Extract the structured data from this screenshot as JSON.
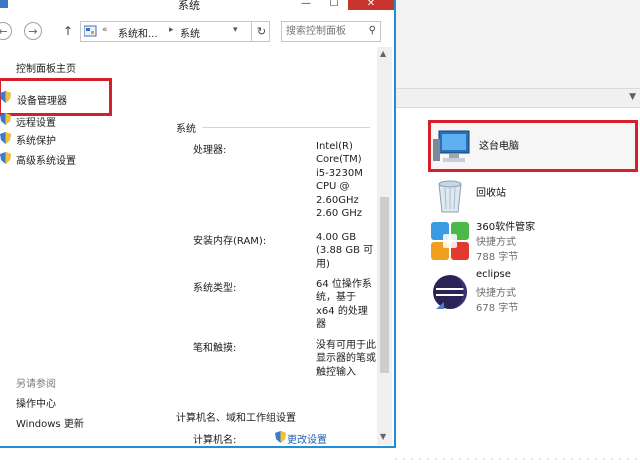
{
  "window": {
    "title": "系统",
    "controls": {
      "minimize": "—",
      "maximize": "☐",
      "close": "✕"
    }
  },
  "address_bar": {
    "back_icon": "back-arrow-icon",
    "forward_icon": "forward-arrow-icon",
    "up_icon": "up-arrow-icon",
    "prefix": "«",
    "crumbs": [
      "系统和...",
      "系统"
    ],
    "search_placeholder": "搜索控制面板"
  },
  "left_nav": {
    "home": "控制面板主页",
    "links": [
      "设备管理器",
      "远程设置",
      "系统保护",
      "高级系统设置"
    ],
    "see_also_title": "另请参阅",
    "see_also": [
      "操作中心",
      "Windows 更新"
    ]
  },
  "system_section": {
    "title": "系统",
    "rows": [
      {
        "label": "处理器:",
        "value": "Intel(R) Core(TM) i5-3230M CPU @ 2.60GHz 2.60 GHz"
      },
      {
        "label": "安装内存(RAM):",
        "value": "4.00 GB (3.88 GB 可用)"
      },
      {
        "label": "系统类型:",
        "value": "64 位操作系统，基于 x64 的处理器"
      },
      {
        "label": "笔和触摸:",
        "value": "没有可用于此显示器的笔或触控输入"
      }
    ]
  },
  "computer_section": {
    "title": "计算机名、域和工作组设置",
    "row_label": "计算机名:",
    "change_link": "更改设置"
  },
  "desktop_items": [
    {
      "name": "这台电脑",
      "icon": "computer-icon",
      "selected": true
    },
    {
      "name": "回收站",
      "icon": "recycle-bin-icon"
    },
    {
      "name": "360软件管家",
      "sub1": "快捷方式",
      "sub2": "788 字节",
      "icon": "360-app-icon"
    },
    {
      "name": "eclipse",
      "sub1": "快捷方式",
      "sub2": "678 字节",
      "icon": "eclipse-icon"
    }
  ],
  "colors": {
    "highlight": "#d3202a",
    "window_border": "#1f8fd6",
    "link": "#1a5fb4"
  }
}
